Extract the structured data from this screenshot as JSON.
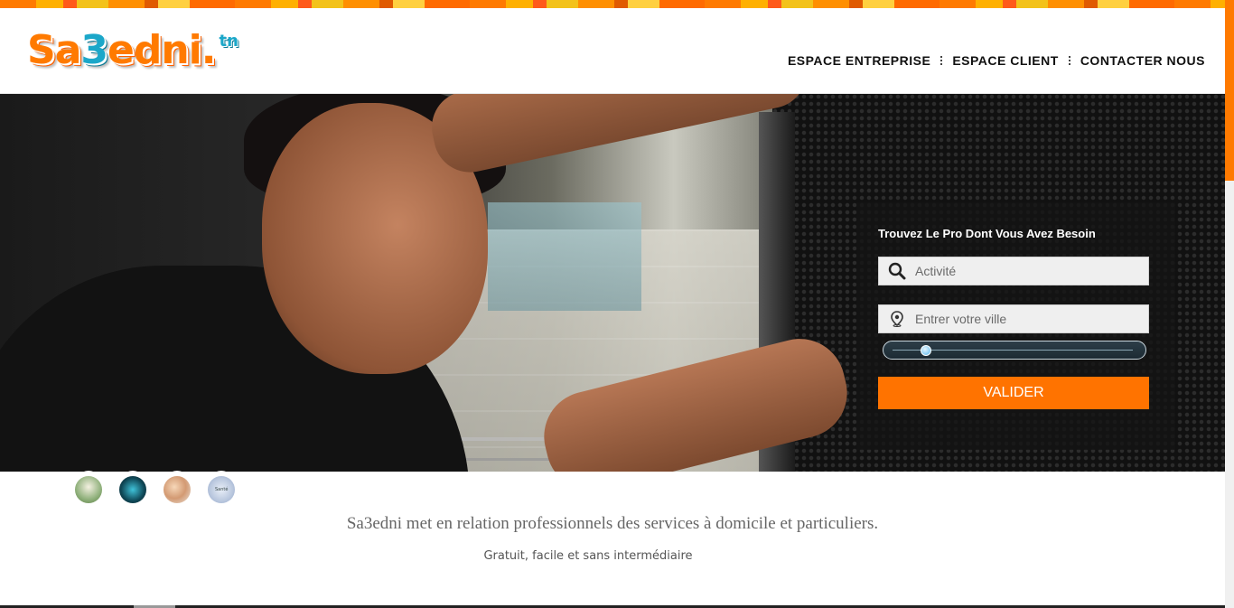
{
  "logo": {
    "main_a": "Sa",
    "main_b": "3",
    "main_c": "edni.",
    "tld": "tn"
  },
  "nav": {
    "items": [
      {
        "label": "ESPACE ENTREPRISE"
      },
      {
        "label": "ESPACE CLIENT"
      },
      {
        "label": "CONTACTER NOUS"
      }
    ]
  },
  "search": {
    "title": "Trouvez Le Pro Dont Vous Avez Besoin",
    "activity_placeholder": "Activité",
    "city_placeholder": "Entrer votre ville",
    "submit_label": "VALIDER",
    "radius_fraction": 0.13
  },
  "categories": {
    "health_thumb_label": "Santé"
  },
  "content": {
    "tagline": "Sa3edni met en relation professionnels des services à domicile et particuliers.",
    "subline": "Gratuit, facile et sans intermédiaire"
  },
  "colors": {
    "accent": "#ff7300",
    "brand_blue": "#1ba7c9"
  }
}
